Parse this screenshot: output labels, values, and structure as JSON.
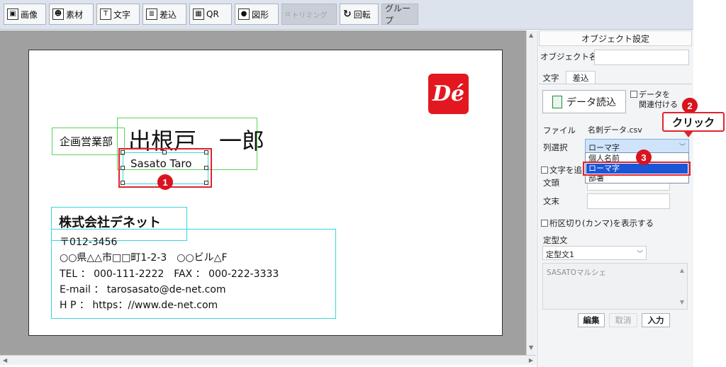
{
  "toolbar": {
    "buttons": [
      {
        "label": "画像",
        "icon": "image-icon",
        "icon_glyph": "▣"
      },
      {
        "label": "素材",
        "icon": "material-icon",
        "icon_glyph": "☻"
      },
      {
        "label": "文字",
        "icon": "text-icon",
        "icon_glyph": "T"
      },
      {
        "label": "差込",
        "icon": "merge-icon",
        "icon_glyph": "≣"
      },
      {
        "label": "QR",
        "icon": "qr-icon",
        "icon_glyph": "▦"
      },
      {
        "label": "図形",
        "icon": "shape-icon",
        "icon_glyph": "●"
      },
      {
        "label": "トリミング",
        "icon": "trim-icon",
        "icon_glyph": "⌗"
      },
      {
        "label": "回転",
        "icon": "rotate-icon",
        "icon_glyph": "↻"
      },
      {
        "label": "グループ",
        "icon": "",
        "icon_glyph": ""
      }
    ]
  },
  "card": {
    "department": "企画営業部",
    "name": "出根戸　一郎",
    "romaji": "Sasato Taro",
    "company": "株式会社デネット",
    "address_lines": [
      "〒012-3456",
      "○○県△△市□□町1-2-3　○○ビル△F",
      "TEL ： 000-111-2222　FAX ： 000-222-3333",
      "E-mail ： tarosasato@de-net.com",
      "H P ： https：//www.de-net.com"
    ],
    "logo_text": "Dé",
    "logo_color": "#e3171f"
  },
  "badges": {
    "b1": "1",
    "b2": "2",
    "b3": "3"
  },
  "callout": {
    "label": "クリック"
  },
  "panel": {
    "title": "オブジェクト設定",
    "object_name_label": "オブジェクト名",
    "object_name_value": "",
    "tabs": [
      "文字",
      "差込"
    ],
    "read_data_button": "データ読込",
    "link_data_checkbox": "データを\n関連付ける",
    "file_label": "ファイル",
    "file_value": "名刺データ.csv",
    "column_label": "列選択",
    "column_value": "ローマ字",
    "column_options": [
      "個人名前",
      "ローマ字",
      "部署"
    ],
    "column_highlighted": "ローマ字",
    "add_text_checkbox": "文字を追",
    "prefix_label": "文頭",
    "suffix_label": "文末",
    "comma_checkbox": "桁区切り(カンマ)を表示する",
    "template_label": "定型文",
    "template_value": "定型文1",
    "template_preview": "SASATOマルシェ",
    "edit_button": "編集",
    "cancel_button": "取消",
    "input_button": "入力"
  },
  "colors": {
    "accent_red": "#e0242f",
    "selection_blue": "#1a56d6",
    "guide_green": "#5fd35f",
    "guide_cyan": "#37d6dc"
  }
}
